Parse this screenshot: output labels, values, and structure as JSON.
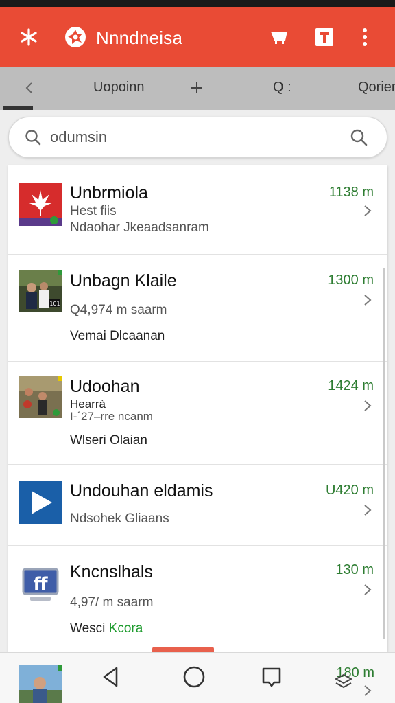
{
  "app": {
    "title": "Nnndneisa",
    "accent": "#e94b35",
    "icons": [
      "menu-icon",
      "logo-icon",
      "cart-icon",
      "text-icon",
      "more-icon"
    ]
  },
  "tabs": {
    "items": [
      "Uopoinn",
      "Q :",
      "Qoriem"
    ]
  },
  "search": {
    "query": "odumsin"
  },
  "items": [
    {
      "title": "Unbrmiola",
      "line1": "Hest fiis",
      "line2": "Ndaohar Jkeaadsanram",
      "time": "1138 m"
    },
    {
      "title": "Unbagn Klaile",
      "line1": "Q4,974 m saarm",
      "line2": "Vemai Dlcaanan",
      "time": "1300 m",
      "thumb_badge": "101"
    },
    {
      "title": "Udoohan",
      "line1": "Hearrà",
      "line1b": "I-´27–rre ncanm",
      "line2": "Wlseri Olaian",
      "time": "1424 m"
    },
    {
      "title": "Undouhan eldamis",
      "line1": "Ndsohek Gliaans",
      "time": "U420 m"
    },
    {
      "title": "Kncnslhals",
      "line1": "4,97/ m saarm",
      "line2a": "Wesci",
      "line2b": "Kcora",
      "time": "130 m",
      "thumb_text": "ff"
    }
  ],
  "bottom": {
    "time": "180 m"
  }
}
